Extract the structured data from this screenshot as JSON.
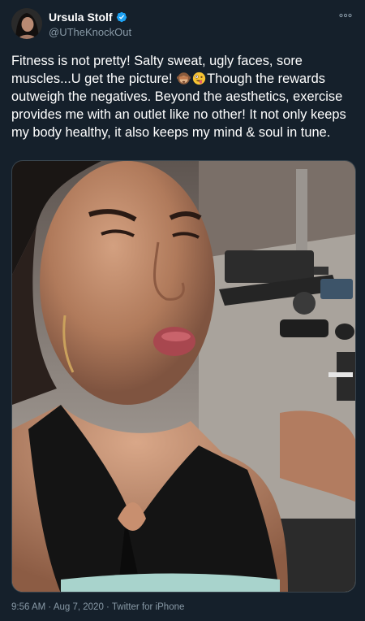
{
  "tweet": {
    "author": {
      "display_name": "Ursula Stolf",
      "handle": "@UTheKnockOut",
      "verified": true
    },
    "text_parts": [
      "Fitness is not pretty! Salty sweat, ugly faces, sore muscles...U get the picture! ",
      "Though the rewards outweigh the negatives. Beyond the aesthetics, exercise provides me with an outlet like no other! It not only keeps my body healthy, it also keeps my mind & soul in tune."
    ],
    "emojis": [
      "see-no-evil-monkey",
      "zany-face"
    ],
    "timestamp": {
      "time": "9:56 AM",
      "date": "Aug 7, 2020",
      "source": "Twitter for iPhone",
      "separator": "·"
    }
  },
  "colors": {
    "background": "#15202b",
    "secondary_text": "#8899a6",
    "verified_blue": "#1da1f2",
    "border": "#38444d"
  }
}
